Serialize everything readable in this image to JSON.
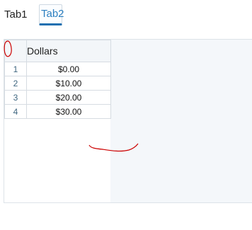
{
  "tabs": [
    {
      "label": "Tab1",
      "active": false
    },
    {
      "label": "Tab2",
      "active": true
    }
  ],
  "sheet": {
    "column_header": "Dollars",
    "rows": [
      {
        "num": "1",
        "value": "$0.00"
      },
      {
        "num": "2",
        "value": "$10.00"
      },
      {
        "num": "3",
        "value": "$20.00"
      },
      {
        "num": "4",
        "value": "$30.00"
      }
    ]
  },
  "colors": {
    "active_tab_accent": "#1a6fb0",
    "annotation_stroke": "#cc0000",
    "empty_area": "#f4f7fa"
  }
}
